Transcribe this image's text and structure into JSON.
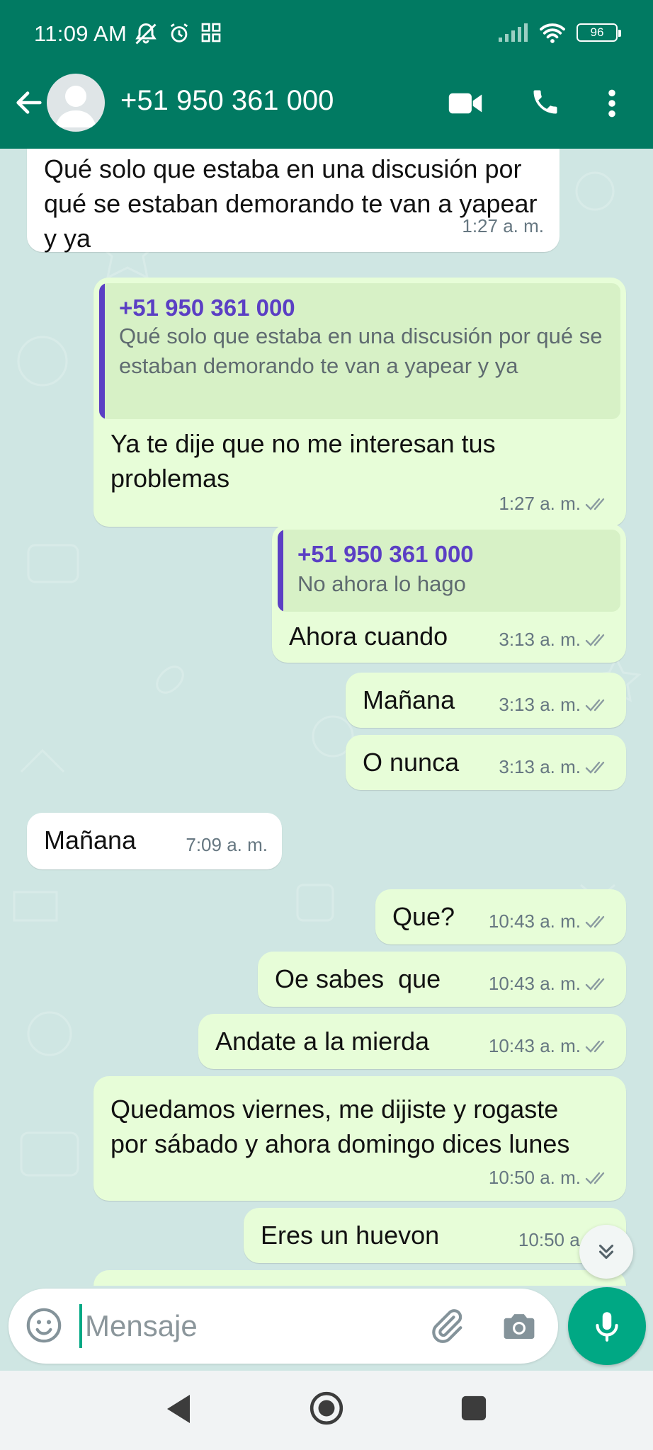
{
  "status_bar": {
    "time": "11:09 AM",
    "battery": "96"
  },
  "header": {
    "contact_name": "+51 950 361 000"
  },
  "messages": [
    {
      "dir": "in",
      "text": "Qué solo que estaba en una discusión por qué se estaban demorando te van a yapear y ya",
      "time": "1:27 a. m."
    },
    {
      "dir": "out",
      "quote_name": "+51 950 361 000",
      "quote_text": "Qué solo que estaba en una discusión por qué se estaban demorando te van a yapear y ya",
      "text": "Ya te dije que no me interesan tus problemas",
      "time": "1:27 a. m."
    },
    {
      "dir": "out",
      "quote_name": "+51 950 361 000",
      "quote_text": "No ahora lo hago",
      "text": "Ahora cuando",
      "time": "3:13 a. m."
    },
    {
      "dir": "out",
      "text": "Mañana",
      "time": "3:13 a. m."
    },
    {
      "dir": "out",
      "text": "O nunca",
      "time": "3:13 a. m."
    },
    {
      "dir": "in",
      "text": "Mañana",
      "time": "7:09 a. m."
    },
    {
      "dir": "out",
      "text": "Que?",
      "time": "10:43 a. m."
    },
    {
      "dir": "out",
      "text": "Oe sabes  que",
      "time": "10:43 a. m."
    },
    {
      "dir": "out",
      "text": "Andate a la mierda",
      "time": "10:43 a. m."
    },
    {
      "dir": "out",
      "text": "Quedamos viernes, me dijiste y rogaste por sábado y ahora domingo dices lunes",
      "time": "10:50 a. m."
    },
    {
      "dir": "out",
      "text": "Eres un huevon",
      "time": "10:50 a. m."
    }
  ],
  "composer": {
    "placeholder": "Mensaje"
  },
  "colors": {
    "header": "#017a62",
    "outgoing": "#e7fdd8",
    "incoming": "#ffffff",
    "accent": "#00a884",
    "quote_bar": "#5b3fc4"
  },
  "icons": [
    "back-arrow-icon",
    "video-call-icon",
    "phone-icon",
    "more-options-icon",
    "emoji-icon",
    "attach-icon",
    "camera-icon",
    "mic-icon",
    "scroll-down-icon",
    "read-ticks-icon"
  ]
}
